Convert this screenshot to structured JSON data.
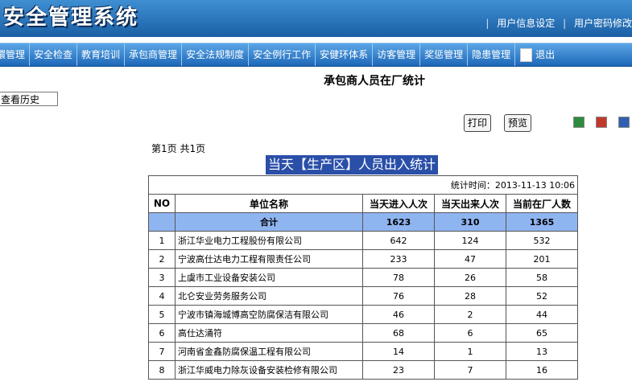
{
  "app": {
    "title": "安全管理系统",
    "links": [
      "用户信息设定",
      "用户密码修改"
    ]
  },
  "nav": {
    "items": [
      "環管理",
      "安全检查",
      "教育培训",
      "承包商管理",
      "安全法规制度",
      "安全例行工作",
      "安健环体系",
      "访客管理",
      "奖惩管理",
      "隐患管理"
    ],
    "logout": "退出"
  },
  "page": {
    "title": "承包商人员在厂统计",
    "history_button": "查看历史",
    "print_button": "打印",
    "preview_button": "预览",
    "page_info": "第1页 共1页",
    "export_icons": [
      "excel-export-icon",
      "pdf-export-icon",
      "word-export-icon"
    ]
  },
  "report": {
    "title": "当天【生产区】人员出入统计",
    "stat_time": "统计时间：2013-11-13 10:06",
    "columns": [
      "NO",
      "单位名称",
      "当天进入人次",
      "当天出来人次",
      "当前在厂人数"
    ],
    "total": {
      "label": "合计",
      "in": "1623",
      "out": "310",
      "current": "1365"
    },
    "rows": [
      {
        "no": "1",
        "name": "浙江华业电力工程股份有限公司",
        "in": "642",
        "out": "124",
        "current": "532"
      },
      {
        "no": "2",
        "name": "宁波高仕达电力工程有限责任公司",
        "in": "233",
        "out": "47",
        "current": "201"
      },
      {
        "no": "3",
        "name": "上虞市工业设备安装公司",
        "in": "78",
        "out": "26",
        "current": "58"
      },
      {
        "no": "4",
        "name": "北仑安业劳务服务公司",
        "in": "76",
        "out": "28",
        "current": "52"
      },
      {
        "no": "5",
        "name": "宁波市镇海城博高空防腐保洁有限公司",
        "in": "46",
        "out": "2",
        "current": "44"
      },
      {
        "no": "6",
        "name": "高仕达涌符",
        "in": "68",
        "out": "6",
        "current": "65"
      },
      {
        "no": "7",
        "name": "河南省金鑫防腐保温工程有限公司",
        "in": "14",
        "out": "1",
        "current": "13"
      },
      {
        "no": "8",
        "name": "浙江华威电力除灰设备安装检修有限公司",
        "in": "23",
        "out": "7",
        "current": "16"
      }
    ]
  },
  "colors": {
    "header_blue": "#1b5fa5",
    "total_row": "#8fb5f1",
    "title_highlight": "#2a4fa8"
  }
}
